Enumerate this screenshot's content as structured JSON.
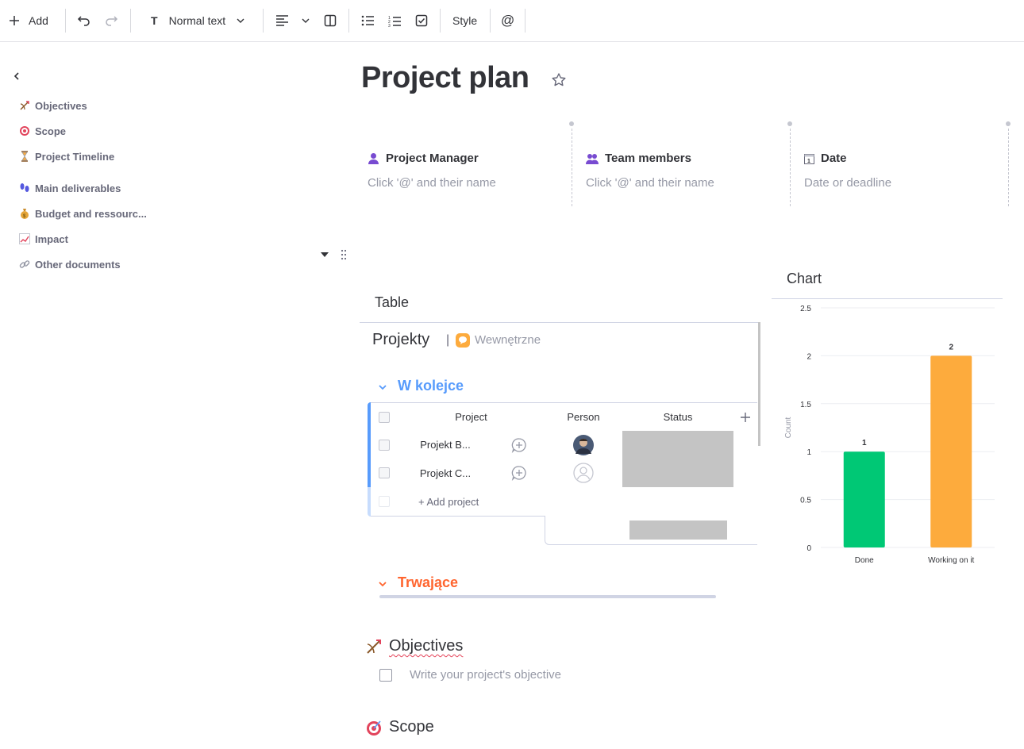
{
  "toolbar": {
    "add_label": "Add",
    "text_style": "Normal text",
    "style_label": "Style",
    "mention_label": "@"
  },
  "sidebar": {
    "items": [
      {
        "label": "Objectives",
        "icon": "bow-arrow-icon"
      },
      {
        "label": "Scope",
        "icon": "target-icon"
      },
      {
        "label": "Project Timeline",
        "icon": "hourglass-icon"
      },
      {
        "label": "Main deliverables",
        "icon": "footprints-icon"
      },
      {
        "label": "Budget and ressourc...",
        "icon": "money-bag-icon"
      },
      {
        "label": "Impact",
        "icon": "chart-up-icon"
      },
      {
        "label": "Other documents",
        "icon": "link-icon"
      }
    ]
  },
  "page": {
    "title": "Project plan"
  },
  "meta": [
    {
      "label": "Project Manager",
      "placeholder": "Click '@' and their name",
      "icon": "person-icon"
    },
    {
      "label": "Team members",
      "placeholder": "Click '@' and their name",
      "icon": "people-icon"
    },
    {
      "label": "Date",
      "placeholder": "Date or deadline",
      "icon": "calendar-icon"
    }
  ],
  "table_widget": {
    "section_title": "Table",
    "board_name": "Projekty",
    "workspace": "Wewnętrzne",
    "columns": [
      "Project",
      "Person",
      "Status"
    ],
    "groups": [
      {
        "title": "W kolejce",
        "color": "#579bfc",
        "rows": [
          {
            "project": "Projekt B...",
            "person": "avatar",
            "status": ""
          },
          {
            "project": "Projekt C...",
            "person": "empty",
            "status": ""
          }
        ],
        "add_label": "+ Add project"
      },
      {
        "title": "Trwające",
        "color": "#ff642e"
      }
    ]
  },
  "doc": {
    "objectives_heading": "Objectives",
    "objectives_todo": "Write your project's objective",
    "scope_heading": "Scope"
  },
  "chart_data": {
    "type": "bar",
    "title": "Chart",
    "categories": [
      "Done",
      "Working on it"
    ],
    "values": [
      1,
      2
    ],
    "colors": [
      "#00c875",
      "#fdab3d"
    ],
    "ylabel": "Count",
    "ylim": [
      0,
      2.5
    ],
    "yticks": [
      "0",
      "0.5",
      "1",
      "1.5",
      "2",
      "2.5"
    ],
    "data_labels": [
      "1",
      "2"
    ]
  }
}
